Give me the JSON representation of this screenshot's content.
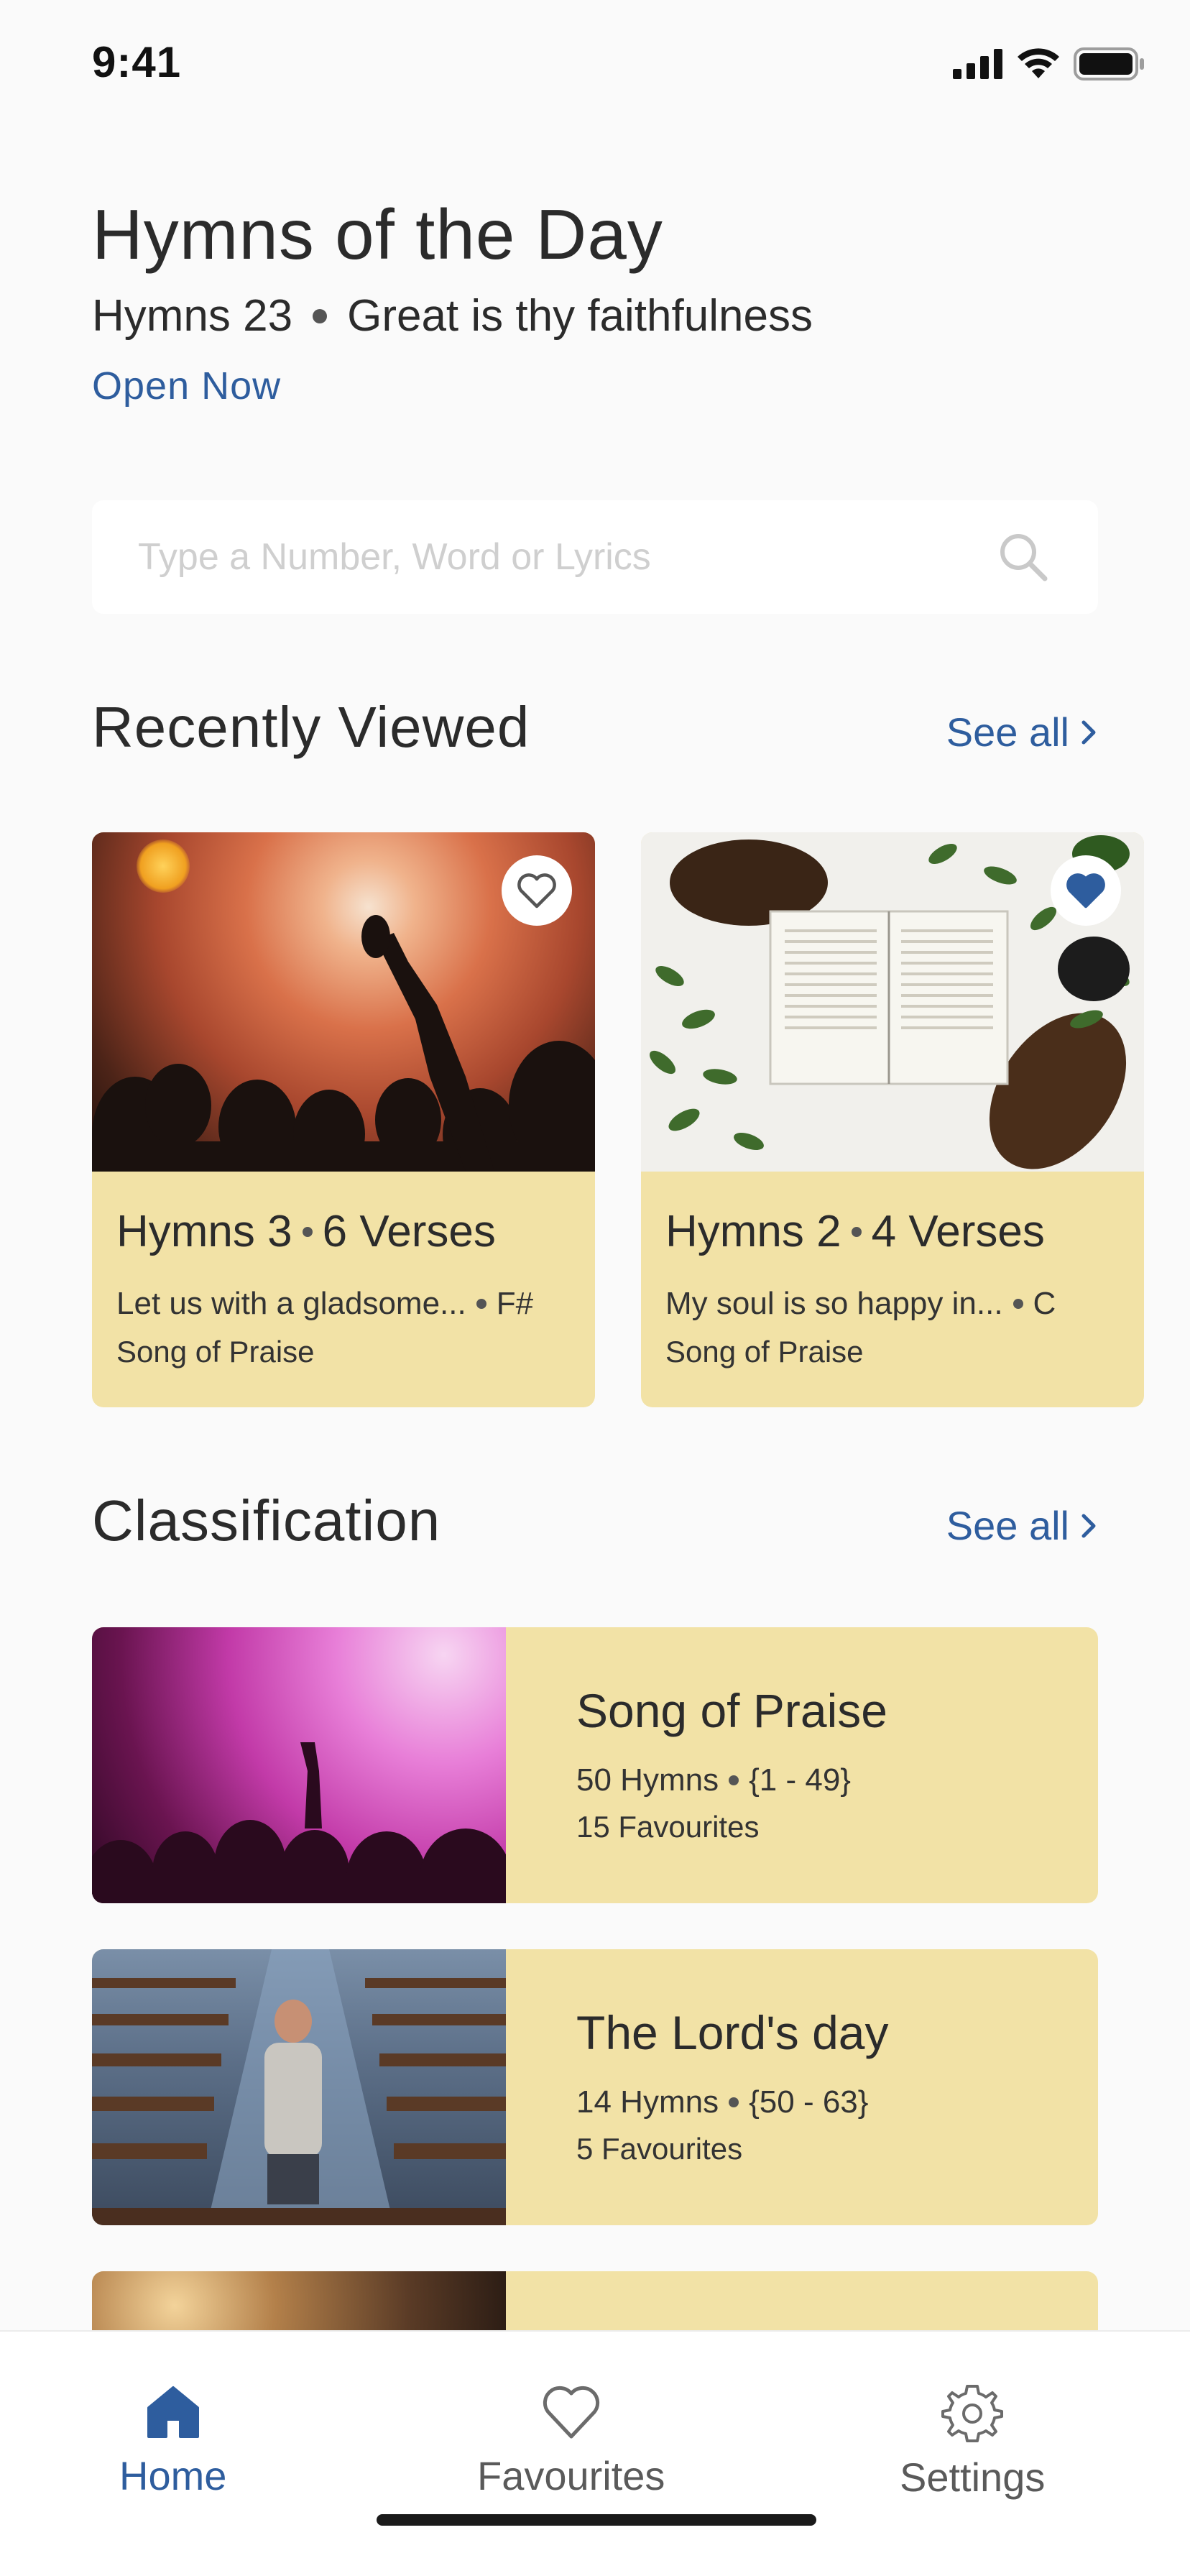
{
  "status_bar": {
    "time": "9:41"
  },
  "hero": {
    "title": "Hymns of the Day",
    "hymn_number": "Hymns 23",
    "hymn_name": "Great is thy faithfulness",
    "link": "Open Now"
  },
  "search": {
    "placeholder": "Type a Number, Word or Lyrics"
  },
  "recently_viewed": {
    "title": "Recently Viewed",
    "see_all": "See all",
    "cards": [
      {
        "hymn": "Hymns 3",
        "verses": "6 Verses",
        "lyrics": "Let us with a gladsome...",
        "key": "F#",
        "category": "Song of Praise",
        "favourite": false
      },
      {
        "hymn": "Hymns 2",
        "verses": "4 Verses",
        "lyrics": "My soul is so happy in...",
        "key": "C",
        "category": "Song of Praise",
        "favourite": true
      }
    ]
  },
  "classification": {
    "title": "Classification",
    "see_all": "See all",
    "items": [
      {
        "name": "Song of Praise",
        "hymns": "50 Hymns",
        "range": "{1 - 49}",
        "favourites": "15 Favourites"
      },
      {
        "name": "The Lord's day",
        "hymns": "14 Hymns",
        "range": "{50 - 63}",
        "favourites": "5 Favourites"
      }
    ]
  },
  "tab_bar": {
    "tabs": [
      {
        "label": "Home",
        "icon": "home-icon",
        "active": true
      },
      {
        "label": "Favourites",
        "icon": "heart-icon",
        "active": false
      },
      {
        "label": "Settings",
        "icon": "gear-icon",
        "active": false
      }
    ]
  },
  "colors": {
    "accent": "#2e5d9e",
    "card": "#f2e2a6",
    "background": "#fafafa"
  }
}
